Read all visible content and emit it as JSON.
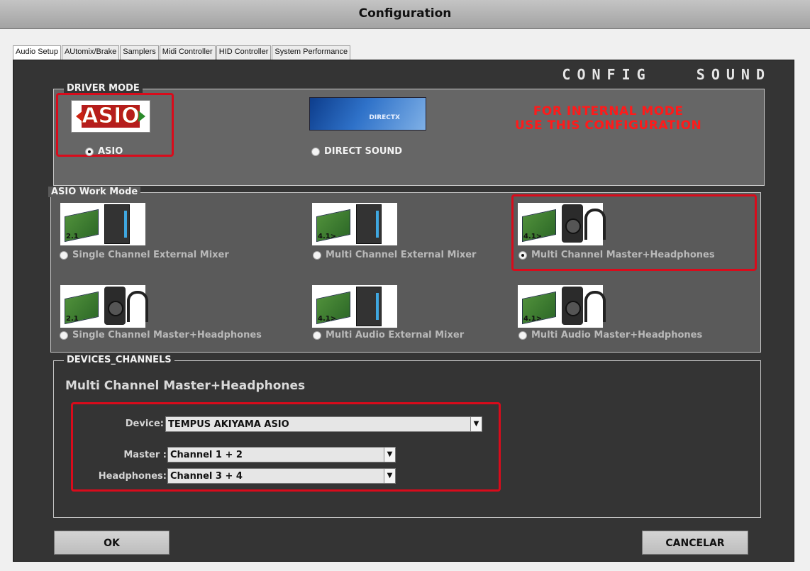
{
  "window": {
    "title": "Configuration"
  },
  "tabs": [
    {
      "label": "Audio Setup",
      "active": true
    },
    {
      "label": "AUtomix/Brake",
      "active": false
    },
    {
      "label": "Samplers",
      "active": false
    },
    {
      "label": "Midi Controller",
      "active": false
    },
    {
      "label": "HID Controller",
      "active": false
    },
    {
      "label": "System Performance",
      "active": false
    }
  ],
  "heading": "CONFIG   SOUND",
  "driver_mode": {
    "legend": "DRIVER MODE",
    "options": [
      {
        "label": "ASIO",
        "selected": true,
        "logo": "ASIO"
      },
      {
        "label": "DIRECT SOUND",
        "selected": false,
        "logo": "DIRECTX"
      }
    ],
    "warning_line1": "FOR INTERNAL MODE",
    "warning_line2": "USE THIS CONFIGURATION"
  },
  "asio_work_mode": {
    "legend": "ASIO Work Mode",
    "options": [
      {
        "label": "Single Channel External Mixer",
        "selected": false,
        "badge": "2.1"
      },
      {
        "label": "Multi Channel External Mixer",
        "selected": false,
        "badge": "4.1>"
      },
      {
        "label": "Multi Channel Master+Headphones",
        "selected": true,
        "badge": "4.1>"
      },
      {
        "label": "Single Channel Master+Headphones",
        "selected": false,
        "badge": "2.1"
      },
      {
        "label": "Multi Audio External Mixer",
        "selected": false,
        "badge": "4.1>"
      },
      {
        "label": "Multi Audio Master+Headphones",
        "selected": false,
        "badge": "4.1>"
      }
    ]
  },
  "devices_channels": {
    "legend": "DEVICES_CHANNELS",
    "selected_mode": "Multi Channel Master+Headphones",
    "device_label": "Device:",
    "device_value": "TEMPUS AKIYAMA ASIO",
    "master_label": "Master :",
    "master_value": "Channel 1 + 2",
    "headphones_label": "Headphones:",
    "headphones_value": "Channel 3 + 4"
  },
  "buttons": {
    "ok": "OK",
    "cancel": "CANCELAR"
  },
  "colors": {
    "highlight": "#d90b1b",
    "warning_text": "#ff1a1a",
    "panel": "#343434"
  }
}
